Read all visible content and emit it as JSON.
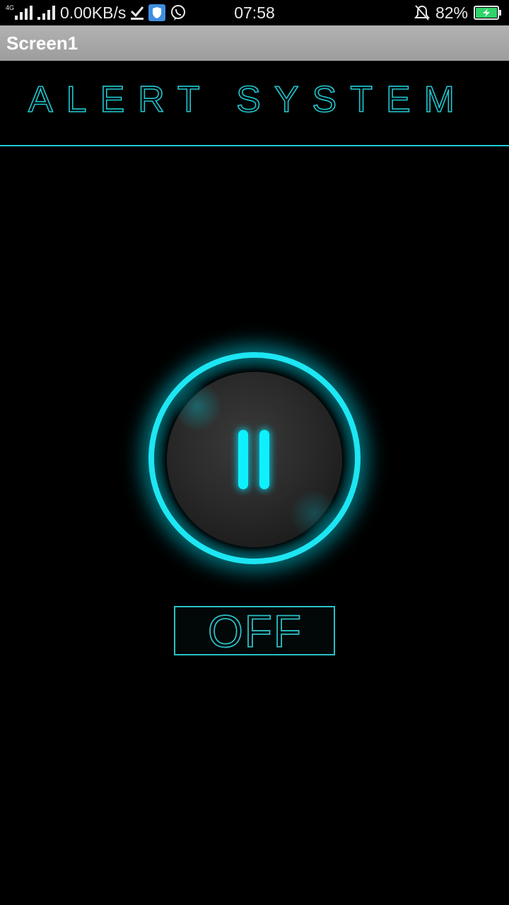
{
  "status_bar": {
    "network_type": "4G",
    "speed": "0.00KB/s",
    "time": "07:58",
    "battery": "82%",
    "icons": [
      "signal-icon",
      "signal-icon",
      "download-done-icon",
      "shield-icon",
      "viber-icon",
      "bell-off-icon",
      "battery-charging-icon"
    ]
  },
  "app_bar": {
    "title": "Screen1"
  },
  "heading": {
    "text": "ALERT SYSTEM"
  },
  "power_button": {
    "icon": "pause-icon",
    "state_label": "OFF"
  },
  "colors": {
    "accent": "#1de6f2",
    "heading": "#1fc9d2",
    "background": "#000000",
    "app_bar": "#a8a8a8"
  }
}
